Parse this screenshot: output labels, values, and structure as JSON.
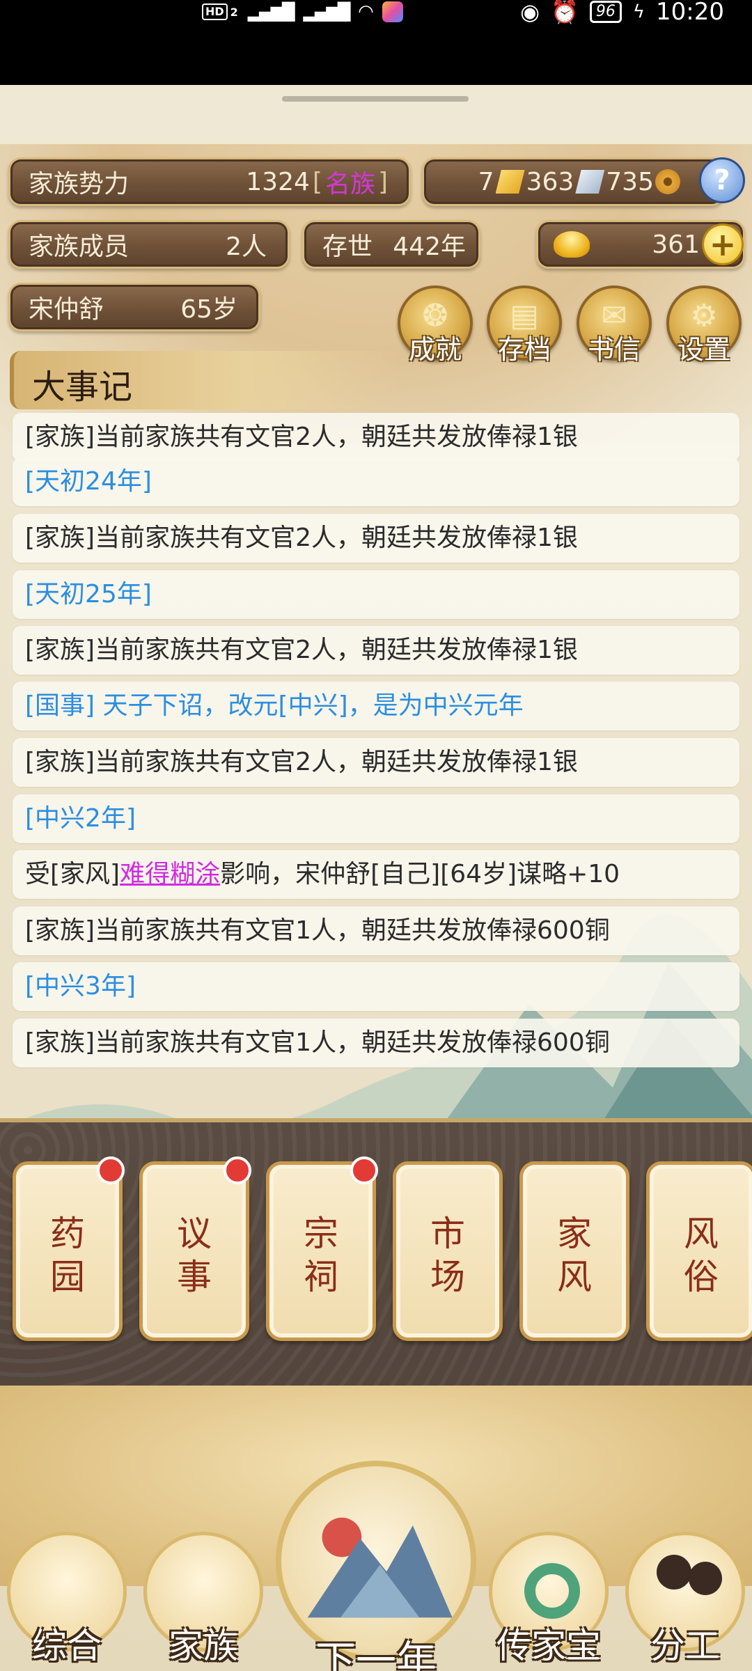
{
  "status_bar": {
    "hd_label": "HD",
    "sim_number": "2",
    "signal_1": "5G",
    "signal_2": "4G",
    "battery": "96",
    "time": "10:20"
  },
  "hud": {
    "power_label": "家族势力",
    "power_value": "1324",
    "power_rank": "名族",
    "gold_count": "7",
    "silver_count": "363",
    "copper_count": "735",
    "members_label": "家族成员",
    "members_value": "2人",
    "exist_label": "存世",
    "exist_value": "442年",
    "ingot_count": "361",
    "leader_name": "宋仲舒",
    "leader_age": "65岁",
    "help_label": "?",
    "plus_label": "+"
  },
  "menu": [
    {
      "label": "成就",
      "icon": "achievement-icon"
    },
    {
      "label": "存档",
      "icon": "save-icon"
    },
    {
      "label": "书信",
      "icon": "letter-icon"
    },
    {
      "label": "设置",
      "icon": "settings-icon"
    }
  ],
  "chronicle": {
    "title": "大事记",
    "entries": [
      {
        "type": "normal",
        "text": "[家族]当前家族共有文官2人，朝廷共发放俸禄1银"
      },
      {
        "type": "year",
        "text": "[天初24年]"
      },
      {
        "type": "normal",
        "text": "[家族]当前家族共有文官2人，朝廷共发放俸禄1银"
      },
      {
        "type": "year",
        "text": "[天初25年]"
      },
      {
        "type": "normal",
        "text": "[家族]当前家族共有文官2人，朝廷共发放俸禄1银"
      },
      {
        "type": "year",
        "text": "[国事] 天子下诏，改元[中兴]，是为中兴元年"
      },
      {
        "type": "normal",
        "text": "[家族]当前家族共有文官2人，朝廷共发放俸禄1银"
      },
      {
        "type": "year",
        "text": "[中兴2年]"
      },
      {
        "type": "rich",
        "prefix": "受[家风]",
        "highlight": "难得糊涂",
        "suffix": "影响，宋仲舒[自己][64岁]谋略+10"
      },
      {
        "type": "normal",
        "text": "[家族]当前家族共有文官1人，朝廷共发放俸禄600铜"
      },
      {
        "type": "year",
        "text": "[中兴3年]"
      },
      {
        "type": "normal",
        "text": "[家族]当前家族共有文官1人，朝廷共发放俸禄600铜"
      }
    ]
  },
  "cards": [
    {
      "line1": "药",
      "line2": "园",
      "badge": true
    },
    {
      "line1": "议",
      "line2": "事",
      "badge": true
    },
    {
      "line1": "宗",
      "line2": "祠",
      "badge": true
    },
    {
      "line1": "市",
      "line2": "场",
      "badge": false
    },
    {
      "line1": "家",
      "line2": "风",
      "badge": false
    },
    {
      "line1": "风",
      "line2": "俗",
      "badge": false
    }
  ],
  "nav": {
    "overview": "综合",
    "family": "家族",
    "next_year": "下一年",
    "heirloom": "传家宝",
    "division": "分工"
  },
  "colors": {
    "accent_magenta": "#d238d6",
    "log_blue": "#2b8ee0",
    "badge_red": "#e23b36",
    "pill_brown": "#6f5138",
    "gold_trim": "#d9ba7d"
  }
}
